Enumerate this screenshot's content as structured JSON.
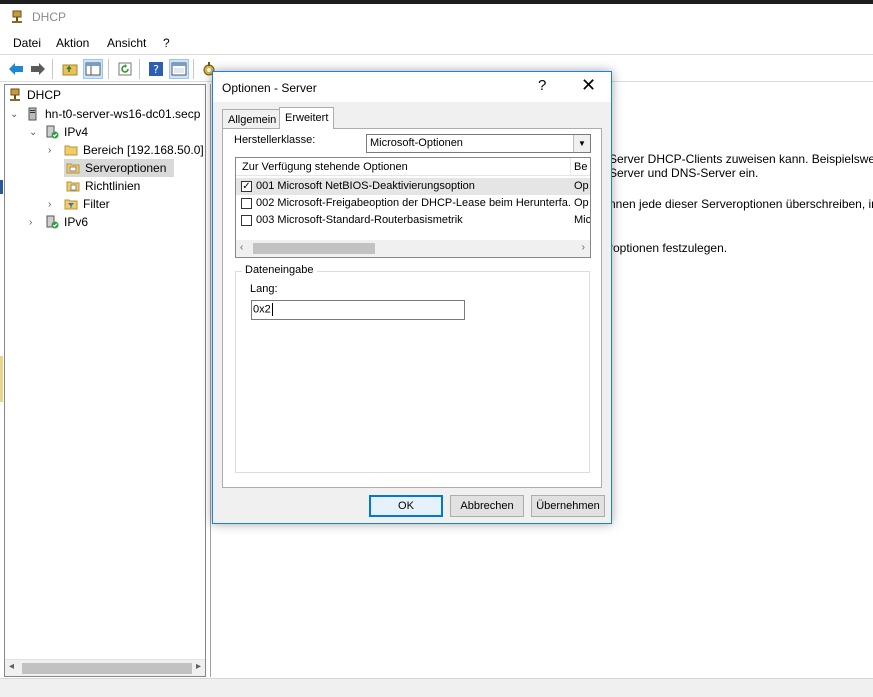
{
  "window": {
    "title": "DHCP"
  },
  "menu": {
    "items": [
      "Datei",
      "Aktion",
      "Ansicht",
      "?"
    ]
  },
  "toolbar": {
    "icons": [
      "back-arrow-icon",
      "forward-arrow-icon",
      "folder-up-icon",
      "show-hide-tree-icon",
      "refresh-icon",
      "help-icon",
      "console-tree-icon",
      "dhcp-options-icon"
    ]
  },
  "tree": {
    "root": "DHCP",
    "server": "hn-t0-server-ws16-dc01.secp",
    "ipv4": "IPv4",
    "scope": "Bereich [192.168.50.0]",
    "server_options": "Serveroptionen",
    "policies": "Richtlinien",
    "filter": "Filter",
    "ipv6": "IPv6"
  },
  "right_pane": {
    "lines": [
      "Server DHCP-Clients zuweisen kann. Beispielsweise",
      "Server und DNS-Server ein.",
      "nnen jede dieser Serveroptionen überschreiben, in",
      "roptionen festzulegen."
    ]
  },
  "dialog": {
    "title": "Optionen - Server",
    "help": "?",
    "close": "✕",
    "tabs": [
      "Allgemein",
      "Erweitert"
    ],
    "active_tab": "Erweitert",
    "vendor_class_label": "Herstellerklasse:",
    "vendor_class_value": "Microsoft-Optionen",
    "list": {
      "columns": [
        "Zur Verfügung stehende Optionen",
        "Be"
      ],
      "rows": [
        {
          "checked": true,
          "name": "001 Microsoft NetBIOS-Deaktivierungsoption",
          "desc": "Op"
        },
        {
          "checked": false,
          "name": "002 Microsoft-Freigabeoption der DHCP-Lease beim Herunterfa...",
          "desc": "Op"
        },
        {
          "checked": false,
          "name": "003 Microsoft-Standard-Routerbasismetrik",
          "desc": "Mic"
        }
      ]
    },
    "data_entry": {
      "group_label": "Dateneingabe",
      "field_label": "Lang:",
      "field_value": "0x2"
    },
    "buttons": {
      "ok": "OK",
      "cancel": "Abbrechen",
      "apply": "Übernehmen"
    }
  },
  "colors": {
    "dialog_border": "#1883d7",
    "selection_gray": "#d9d9d9",
    "default_button_border": "#0078d7"
  }
}
